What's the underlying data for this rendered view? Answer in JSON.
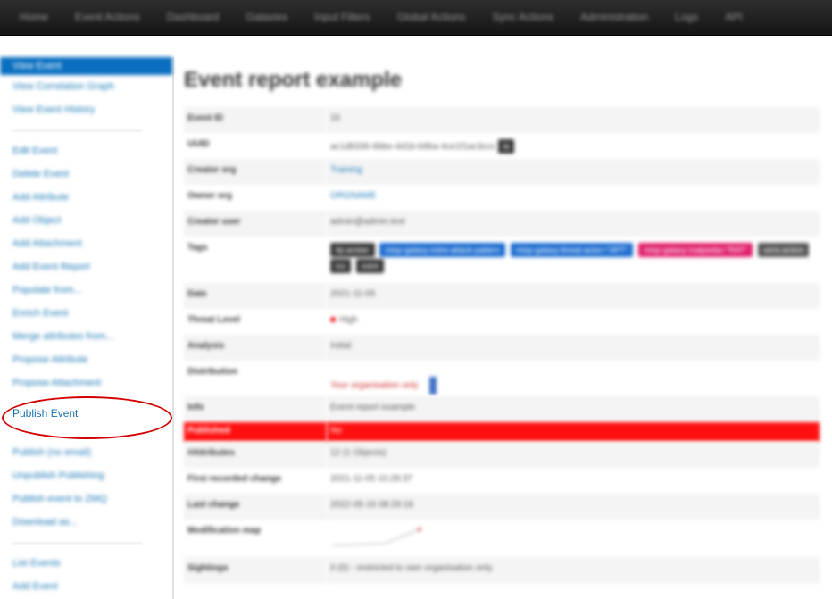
{
  "nav": {
    "items": [
      "Home",
      "Event Actions",
      "Dashboard",
      "Galaxies",
      "Input Filters",
      "Global Actions",
      "Sync Actions",
      "Administration",
      "Logs",
      "API"
    ]
  },
  "sidebar": {
    "group1": [
      "View Event",
      "View Correlation Graph",
      "View Event History"
    ],
    "group2": [
      "Edit Event",
      "Delete Event",
      "Add Attribute",
      "Add Object",
      "Add Attachment",
      "Add Event Report",
      "Populate from...",
      "Enrich Event",
      "Merge attributes from...",
      "Propose Attribute",
      "Propose Attachment"
    ],
    "publish": "Publish Event",
    "group3": [
      "Publish (no email)",
      "Unpublish Publishing",
      "Publish event to ZMQ",
      "Download as..."
    ],
    "group4": [
      "List Events",
      "Add Event"
    ]
  },
  "main": {
    "title": "Event report example",
    "rows": {
      "event_id": {
        "k": "Event ID",
        "v": "15"
      },
      "uuid": {
        "k": "UUID",
        "v": "ac1d8336-6bbe-4d1b-b9ba-4ce1f1ac3ccc"
      },
      "creator_org": {
        "k": "Creator org",
        "v": "Training"
      },
      "owner_org": {
        "k": "Owner org",
        "v": "ORGNAME"
      },
      "creator_user": {
        "k": "Creator user",
        "v": "admin@admin.test"
      },
      "tags": {
        "k": "Tags",
        "items": [
          "tlp:amber",
          "misp-galaxy:mitre-attack-pattern",
          "misp-galaxy:threat-actor=\"APT\"",
          "misp-galaxy:malpedia=\"RAT\"",
          "veris:action",
          "ics",
          "osint"
        ]
      },
      "date": {
        "k": "Date",
        "v": "2021-11-05"
      },
      "threat_level": {
        "k": "Threat Level",
        "v": "High"
      },
      "analysis": {
        "k": "Analysis",
        "v": "Initial"
      },
      "distribution": {
        "k": "Distribution",
        "v": "Your organisation only"
      },
      "info": {
        "k": "Info",
        "v": "Event report example"
      },
      "published": {
        "k": "Published",
        "v": "No"
      },
      "attributes": {
        "k": "#Attributes",
        "v": "12 (1 Objects)"
      },
      "first_recorded": {
        "k": "First recorded change",
        "v": "2021-11-05 10:28:37"
      },
      "last_change": {
        "k": "Last change",
        "v": "2022-05-16 08:29:18"
      },
      "modification_map": {
        "k": "Modification map"
      },
      "sightings": {
        "k": "Sightings",
        "v": "0 (0) - restricted to own organisation only."
      }
    }
  },
  "colors": {
    "published_bar": "#ff1010",
    "annotation_circle": "#d30000",
    "active_sidebar": "#0a6fc0"
  }
}
